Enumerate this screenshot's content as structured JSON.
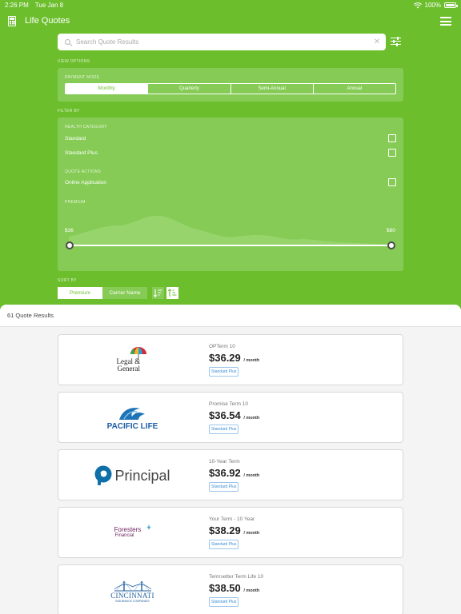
{
  "status_bar": {
    "time": "2:26 PM",
    "date": "Tue Jan 8",
    "battery": "100%"
  },
  "header": {
    "title": "Life Quotes"
  },
  "search": {
    "placeholder": "Search Quote Results"
  },
  "view_options": {
    "label": "VIEW OPTIONS",
    "payment_mode_label": "PAYMENT MODE",
    "modes": [
      "Monthly",
      "Quarterly",
      "Semi-Annual",
      "Annual"
    ],
    "selected_mode": "Monthly"
  },
  "filter": {
    "label": "FILTER BY",
    "health_category_label": "HEALTH CATEGORY",
    "health_options": [
      {
        "label": "Standard",
        "checked": false
      },
      {
        "label": "Standard Plus",
        "checked": false
      }
    ],
    "quote_actions_label": "QUOTE ACTIONS",
    "quote_actions": [
      {
        "label": "Online Application",
        "checked": false
      }
    ],
    "premium_label": "PREMIUM",
    "premium_min": "$36",
    "premium_max": "$80"
  },
  "sort": {
    "label": "SORT BY",
    "options": [
      "Premium",
      "Carrier Name"
    ],
    "selected": "Premium"
  },
  "results": {
    "count_text": "61 Quote Results",
    "quotes": [
      {
        "carrier": "Legal & General",
        "product": "OPTerm 10",
        "price": "$36.29",
        "per": "/ month",
        "badge": "Standard Plus"
      },
      {
        "carrier": "Pacific Life",
        "product": "Promise Term 10",
        "price": "$36.54",
        "per": "/ month",
        "badge": "Standard Plus"
      },
      {
        "carrier": "Principal",
        "product": "10-Year Term",
        "price": "$36.92",
        "per": "/ month",
        "badge": "Standard Plus"
      },
      {
        "carrier": "Foresters Financial",
        "product": "Your Term - 10 Year",
        "price": "$38.29",
        "per": "/ month",
        "badge": "Standard Plus"
      },
      {
        "carrier": "Cincinnati Insurance Companies",
        "product": "Termsetter Term Life 10",
        "price": "$38.50",
        "per": "/ month",
        "badge": "Standard Plus"
      }
    ]
  },
  "logos": {
    "legal_general": {
      "line1": "Legal &",
      "line2": "General"
    },
    "pacific_life": "PACIFIC LIFE",
    "principal": "Principal",
    "foresters": {
      "line1": "Foresters",
      "line2": "Financial"
    },
    "cincinnati": {
      "line1": "CINCINNATI",
      "line2": "INSURANCE COMPANIES"
    }
  },
  "colors": {
    "brand_green": "#6cbe2d",
    "panel_green": "#85cb55",
    "badge_blue": "#3b8fd8"
  }
}
